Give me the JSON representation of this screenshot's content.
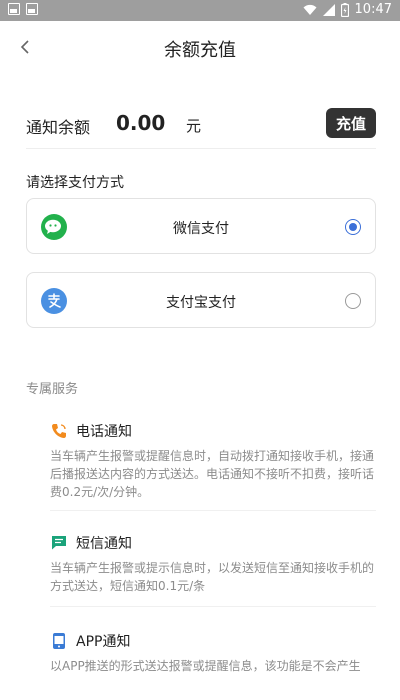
{
  "statusbar": {
    "time": "10:47"
  },
  "header": {
    "title": "余额充值",
    "back_icon": "chevron-left-icon"
  },
  "balance": {
    "label": "通知余额",
    "amount": "0.00",
    "unit": "元",
    "recharge_button": "充值"
  },
  "payment": {
    "section_label": "请选择支付方式",
    "methods": [
      {
        "name": "微信支付",
        "icon": "wechat-icon",
        "selected": true,
        "color": "#22b14c"
      },
      {
        "name": "支付宝支付",
        "icon": "alipay-icon",
        "selected": false,
        "color": "#4a90e2"
      }
    ]
  },
  "services": {
    "section_title": "专属服务",
    "items": [
      {
        "name": "电话通知",
        "icon": "phone-icon",
        "desc": "当车辆产生报警或提醒信息时，自动拨打通知接收手机，接通后播报送达内容的方式送达。电话通知不接听不扣费，接听话费0.2元/次/分钟。"
      },
      {
        "name": "短信通知",
        "icon": "sms-icon",
        "desc": "当车辆产生报警或提示信息时，以发送短信至通知接收手机的方式送达，短信通知0.1元/条"
      },
      {
        "name": "APP通知",
        "icon": "app-icon",
        "desc": "以APP推送的形式送达报警或提醒信息，该功能是不会产生"
      }
    ]
  },
  "colors": {
    "accent": "#3b6fd8",
    "phone": "#f28b1e",
    "sms": "#1aa37a",
    "app": "#3a7bd5"
  }
}
